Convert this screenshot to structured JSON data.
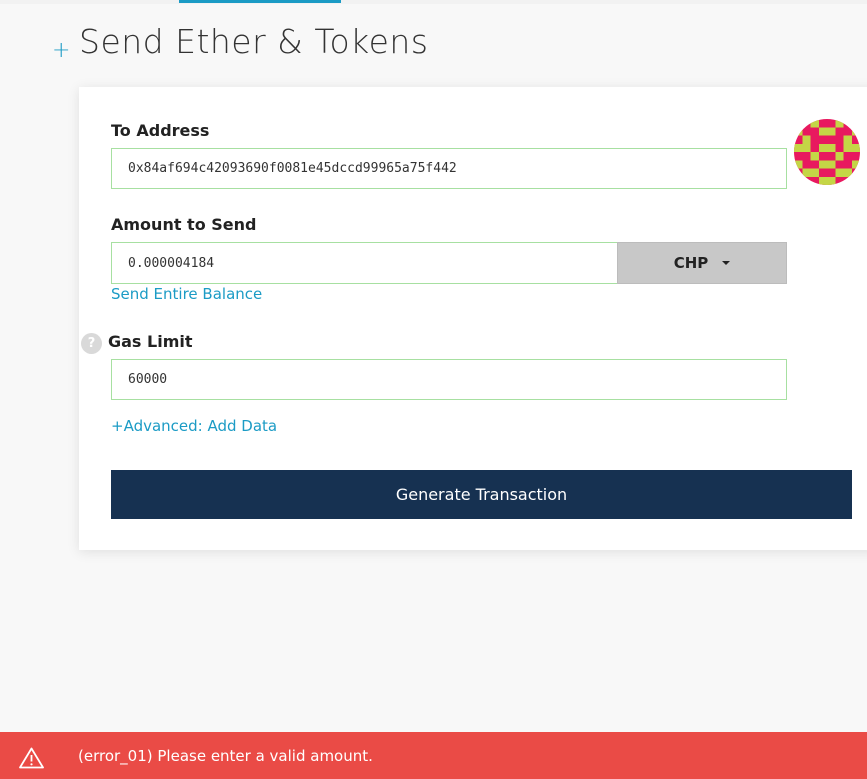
{
  "page": {
    "title": "Send Ether & Tokens",
    "plus_symbol": "+"
  },
  "form": {
    "to_address_label": "To Address",
    "to_address_value": "0x84af694c42093690f0081e45dccd99965a75f442",
    "amount_label": "Amount to Send",
    "amount_value": "0.000004184",
    "unit": "CHP",
    "send_entire_balance": "Send Entire Balance",
    "gas_limit_label": "Gas Limit",
    "gas_limit_value": "60000",
    "help_symbol": "?",
    "advanced_link": "+Advanced: Add Data",
    "generate_button": "Generate Transaction"
  },
  "error": {
    "message": "(error_01) Please enter a valid amount."
  },
  "colors": {
    "accent": "#1b9bc5",
    "field_border": "#a7e0a1",
    "button_dark": "#163151",
    "error_bg": "#ea4b46",
    "identicon_primary": "#e8195f",
    "identicon_secondary": "#c4d646"
  },
  "icons": {
    "header": "plus-icon",
    "address": "identicon-avatar",
    "gas": "question-icon",
    "unit_dropdown": "caret-down-icon",
    "error": "warning-triangle-icon"
  }
}
